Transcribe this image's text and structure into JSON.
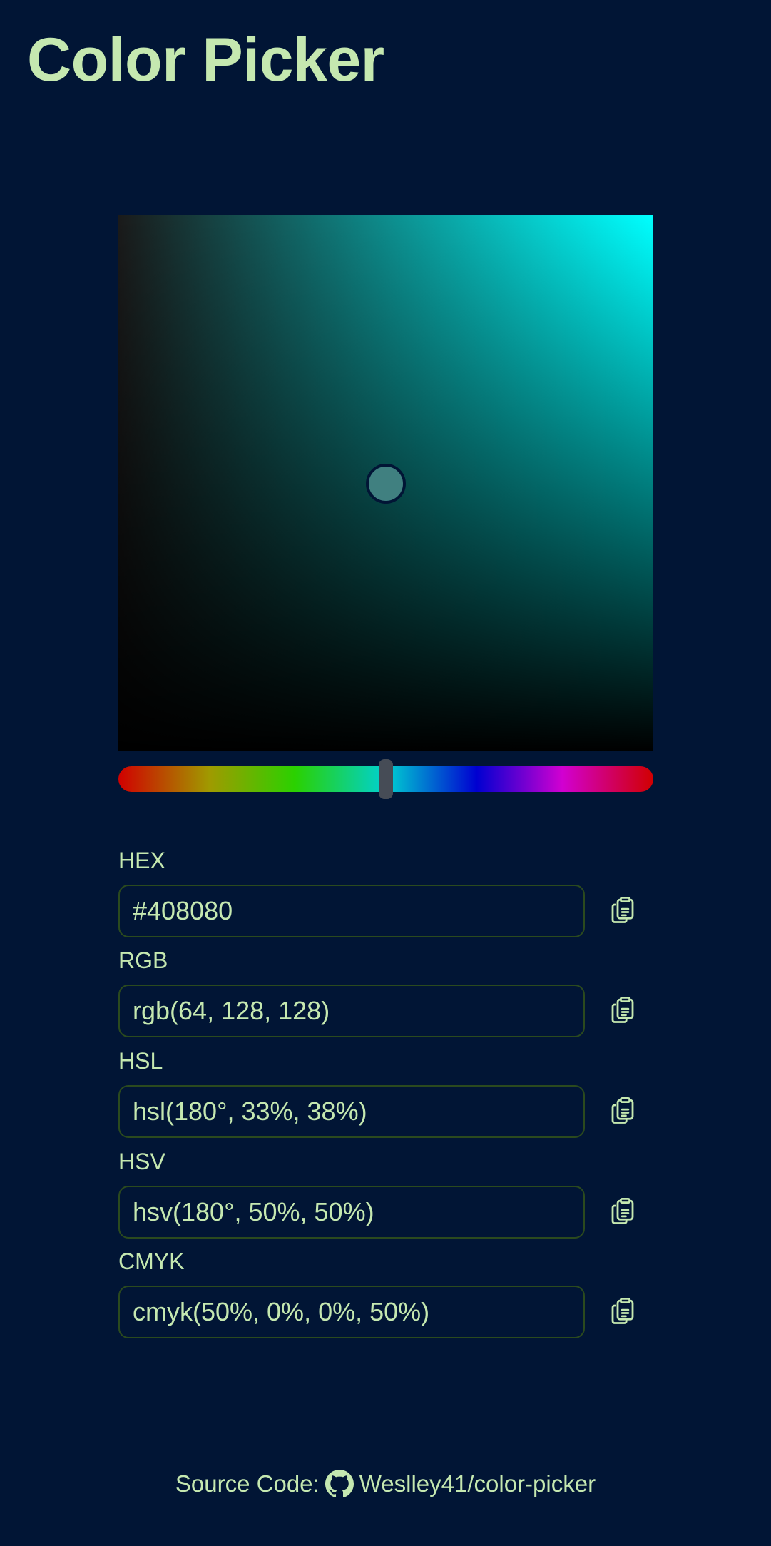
{
  "header": {
    "title": "Color Picker"
  },
  "picker": {
    "hue": 180,
    "saturation": 0.5,
    "value": 0.5,
    "selected_color": "#408080"
  },
  "fields": [
    {
      "label": "HEX",
      "value": "#408080"
    },
    {
      "label": "RGB",
      "value": "rgb(64, 128, 128)"
    },
    {
      "label": "HSL",
      "value": "hsl(180°, 33%, 38%)"
    },
    {
      "label": "HSV",
      "value": "hsv(180°, 50%, 50%)"
    },
    {
      "label": "CMYK",
      "value": "cmyk(50%, 0%, 0%, 50%)"
    }
  ],
  "copy_icon": "clipboard-copy-icon",
  "footer": {
    "prefix": "Source Code:",
    "icon": "github-icon",
    "link_text": "Weslley41/color-picker"
  },
  "colors": {
    "background": "#011535",
    "accent": "#c5e8b0",
    "input_border": "#2b4a1e",
    "hue_handle": "#464c56"
  }
}
